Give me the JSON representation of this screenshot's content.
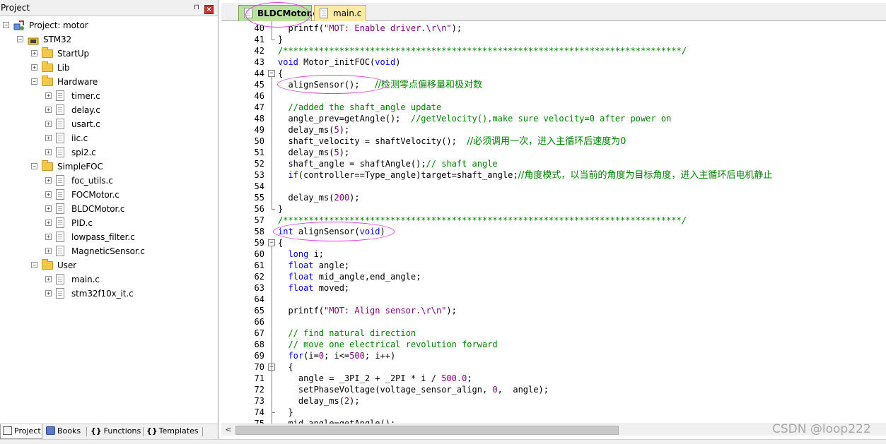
{
  "project_panel": {
    "title": "Project",
    "pin_glyph": "⊓",
    "close_glyph": "×",
    "tree": [
      {
        "label": "Project: motor",
        "level": 0,
        "kind": "project",
        "expander": "−"
      },
      {
        "label": "STM32",
        "level": 1,
        "kind": "target",
        "expander": "−"
      },
      {
        "label": "StartUp",
        "level": 2,
        "kind": "folder",
        "expander": "+"
      },
      {
        "label": "Lib",
        "level": 2,
        "kind": "folder",
        "expander": "+"
      },
      {
        "label": "Hardware",
        "level": 2,
        "kind": "folder",
        "expander": "−"
      },
      {
        "label": "timer.c",
        "level": 3,
        "kind": "file",
        "expander": "+"
      },
      {
        "label": "delay.c",
        "level": 3,
        "kind": "file",
        "expander": "+"
      },
      {
        "label": "usart.c",
        "level": 3,
        "kind": "file",
        "expander": "+"
      },
      {
        "label": "iic.c",
        "level": 3,
        "kind": "file",
        "expander": "+"
      },
      {
        "label": "spi2.c",
        "level": 3,
        "kind": "file",
        "expander": "+"
      },
      {
        "label": "SimpleFOC",
        "level": 2,
        "kind": "folder",
        "expander": "−"
      },
      {
        "label": "foc_utils.c",
        "level": 3,
        "kind": "file",
        "expander": "+"
      },
      {
        "label": "FOCMotor.c",
        "level": 3,
        "kind": "file",
        "expander": "+"
      },
      {
        "label": "BLDCMotor.c",
        "level": 3,
        "kind": "file",
        "expander": "+"
      },
      {
        "label": "PID.c",
        "level": 3,
        "kind": "file",
        "expander": "+"
      },
      {
        "label": "lowpass_filter.c",
        "level": 3,
        "kind": "file",
        "expander": "+"
      },
      {
        "label": "MagneticSensor.c",
        "level": 3,
        "kind": "file",
        "expander": "+"
      },
      {
        "label": "User",
        "level": 2,
        "kind": "folder",
        "expander": "−"
      },
      {
        "label": "main.c",
        "level": 3,
        "kind": "file",
        "expander": "+"
      },
      {
        "label": "stm32f10x_it.c",
        "level": 3,
        "kind": "file",
        "expander": "+"
      }
    ],
    "tabs": [
      {
        "label": "Project",
        "icon": "project-tab-icon"
      },
      {
        "label": "Books",
        "icon": "books-icon"
      },
      {
        "label": "Functions",
        "icon": "functions-icon"
      },
      {
        "label": "Templates",
        "icon": "templates-icon"
      }
    ],
    "tab_glyphs": {
      "functions": "{}",
      "templates": "{}"
    }
  },
  "editor": {
    "tabs": [
      {
        "label": "BLDCMotor.c",
        "active": true
      },
      {
        "label": "main.c",
        "active": false
      }
    ],
    "line_numbers": [
      "40",
      "41",
      "42",
      "43",
      "44",
      "45",
      "46",
      "47",
      "48",
      "49",
      "50",
      "51",
      "52",
      "53",
      "54",
      "55",
      "56",
      "57",
      "58",
      "59",
      "60",
      "61",
      "62",
      "63",
      "64",
      "65",
      "66",
      "67",
      "68",
      "69",
      "70",
      "71",
      "72",
      "73",
      "74",
      "75"
    ],
    "code_lines": [
      [
        {
          "t": "  printf(",
          "c": ""
        },
        {
          "t": "\"MOT: Enable driver.\\r\\n\"",
          "c": "st"
        },
        {
          "t": ");",
          "c": ""
        }
      ],
      [
        {
          "t": "}",
          "c": ""
        }
      ],
      [
        {
          "t": "/******************************************************************************/",
          "c": "cm"
        }
      ],
      [
        {
          "t": "void",
          "c": "kw"
        },
        {
          "t": " Motor_initFOC(",
          "c": ""
        },
        {
          "t": "void",
          "c": "kw"
        },
        {
          "t": ")",
          "c": ""
        }
      ],
      [
        {
          "t": "{",
          "c": ""
        }
      ],
      [
        {
          "t": "  alignSensor();   ",
          "c": ""
        },
        {
          "t": "//检测零点偏移量和极对数",
          "c": "cm"
        }
      ],
      [
        {
          "t": "",
          "c": ""
        }
      ],
      [
        {
          "t": "  //added the shaft_angle update",
          "c": "cm"
        }
      ],
      [
        {
          "t": "  angle_prev=getAngle();  ",
          "c": ""
        },
        {
          "t": "//getVelocity(),make sure velocity=0 after power on",
          "c": "cm"
        }
      ],
      [
        {
          "t": "  delay_ms(",
          "c": ""
        },
        {
          "t": "5",
          "c": "nm"
        },
        {
          "t": ");",
          "c": ""
        }
      ],
      [
        {
          "t": "  shaft_velocity = shaftVelocity();  ",
          "c": ""
        },
        {
          "t": "//必须调用一次，进入主循环后速度为0",
          "c": "cm"
        }
      ],
      [
        {
          "t": "  delay_ms(",
          "c": ""
        },
        {
          "t": "5",
          "c": "nm"
        },
        {
          "t": ");",
          "c": ""
        }
      ],
      [
        {
          "t": "  shaft_angle = shaftAngle();",
          "c": ""
        },
        {
          "t": "// shaft angle",
          "c": "cm"
        }
      ],
      [
        {
          "t": "  ",
          "c": ""
        },
        {
          "t": "if",
          "c": "kw"
        },
        {
          "t": "(controller==Type_angle)target=shaft_angle;",
          "c": ""
        },
        {
          "t": "//角度模式，以当前的角度为目标角度，进入主循环后电机静止",
          "c": "cm"
        }
      ],
      [
        {
          "t": "",
          "c": ""
        }
      ],
      [
        {
          "t": "  delay_ms(",
          "c": ""
        },
        {
          "t": "200",
          "c": "nm"
        },
        {
          "t": ");",
          "c": ""
        }
      ],
      [
        {
          "t": "}",
          "c": ""
        }
      ],
      [
        {
          "t": "/******************************************************************************/",
          "c": "cm"
        }
      ],
      [
        {
          "t": "int",
          "c": "kw"
        },
        {
          "t": " alignSensor(",
          "c": ""
        },
        {
          "t": "void",
          "c": "kw"
        },
        {
          "t": ")",
          "c": ""
        }
      ],
      [
        {
          "t": "{",
          "c": ""
        }
      ],
      [
        {
          "t": "  ",
          "c": ""
        },
        {
          "t": "long",
          "c": "kw"
        },
        {
          "t": " i;",
          "c": ""
        }
      ],
      [
        {
          "t": "  ",
          "c": ""
        },
        {
          "t": "float",
          "c": "kw"
        },
        {
          "t": " angle;",
          "c": ""
        }
      ],
      [
        {
          "t": "  ",
          "c": ""
        },
        {
          "t": "float",
          "c": "kw"
        },
        {
          "t": " mid_angle,end_angle;",
          "c": ""
        }
      ],
      [
        {
          "t": "  ",
          "c": ""
        },
        {
          "t": "float",
          "c": "kw"
        },
        {
          "t": " moved;",
          "c": ""
        }
      ],
      [
        {
          "t": "",
          "c": ""
        }
      ],
      [
        {
          "t": "  printf(",
          "c": ""
        },
        {
          "t": "\"MOT: Align sensor.\\r\\n\"",
          "c": "st"
        },
        {
          "t": ");",
          "c": ""
        }
      ],
      [
        {
          "t": "",
          "c": ""
        }
      ],
      [
        {
          "t": "  // find natural direction",
          "c": "cm"
        }
      ],
      [
        {
          "t": "  // move one electrical revolution forward",
          "c": "cm"
        }
      ],
      [
        {
          "t": "  ",
          "c": ""
        },
        {
          "t": "for",
          "c": "kw"
        },
        {
          "t": "(i=",
          "c": ""
        },
        {
          "t": "0",
          "c": "nm"
        },
        {
          "t": "; i<=",
          "c": ""
        },
        {
          "t": "500",
          "c": "nm"
        },
        {
          "t": "; i++)",
          "c": ""
        }
      ],
      [
        {
          "t": "  {",
          "c": ""
        }
      ],
      [
        {
          "t": "    angle = _3PI_2 + _2PI * i / ",
          "c": ""
        },
        {
          "t": "500.0",
          "c": "nm"
        },
        {
          "t": ";",
          "c": ""
        }
      ],
      [
        {
          "t": "    setPhaseVoltage(voltage_sensor_align, ",
          "c": ""
        },
        {
          "t": "0",
          "c": "nm"
        },
        {
          "t": ",  angle);",
          "c": ""
        }
      ],
      [
        {
          "t": "    delay_ms(",
          "c": ""
        },
        {
          "t": "2",
          "c": "nm"
        },
        {
          "t": ");",
          "c": ""
        }
      ],
      [
        {
          "t": "  }",
          "c": ""
        }
      ],
      [
        {
          "t": "  mid_angle=getAngle();",
          "c": ""
        }
      ]
    ]
  },
  "scrollbar": {
    "left_arrow": "<"
  },
  "watermark": "CSDN @loop222",
  "colors": {
    "keyword": "#0000ff",
    "comment": "#008000",
    "string": "#800080",
    "highlight": "#e040e0",
    "active_tab": "#b9e0a0",
    "inactive_tab": "#fdeaa6"
  }
}
